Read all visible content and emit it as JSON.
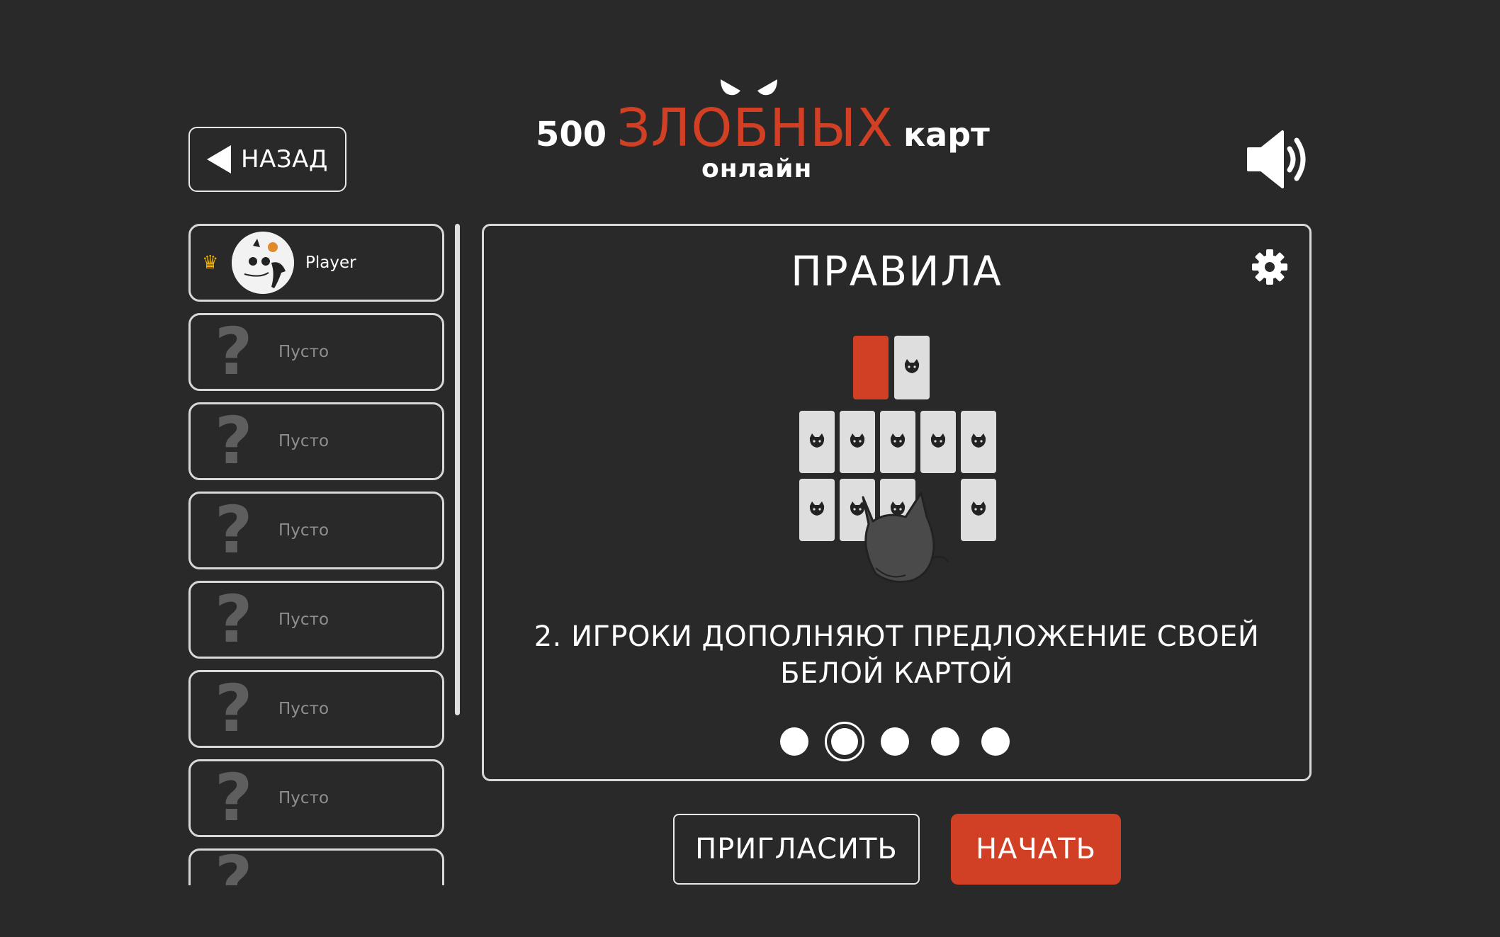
{
  "header": {
    "back_label": "НАЗАД",
    "logo": {
      "number": "500",
      "evil_word": "ЗЛОБНЫХ",
      "cards_word": "карт",
      "subtitle": "онлайн"
    },
    "sound_icon": "speaker-volume-icon"
  },
  "players": {
    "host": {
      "name": "Player",
      "crown_icon": "crown-icon"
    },
    "empty_label": "Пусто",
    "empty_icon": "question-mark-icon"
  },
  "rules": {
    "title": "ПРАВИЛА",
    "settings_icon": "gear-icon",
    "caption": "2. ИГРОКИ ДОПОЛНЯЮТ ПРЕДЛОЖЕНИЕ СВОЕЙ БЕЛОЙ КАРТОЙ",
    "current_step": 2,
    "total_steps": 5
  },
  "actions": {
    "invite_label": "ПРИГЛАСИТЬ",
    "start_label": "НАЧАТЬ"
  },
  "colors": {
    "background": "#292929",
    "accent_red": "#d13f24",
    "card_white": "#dedede",
    "text": "#ffffff"
  }
}
